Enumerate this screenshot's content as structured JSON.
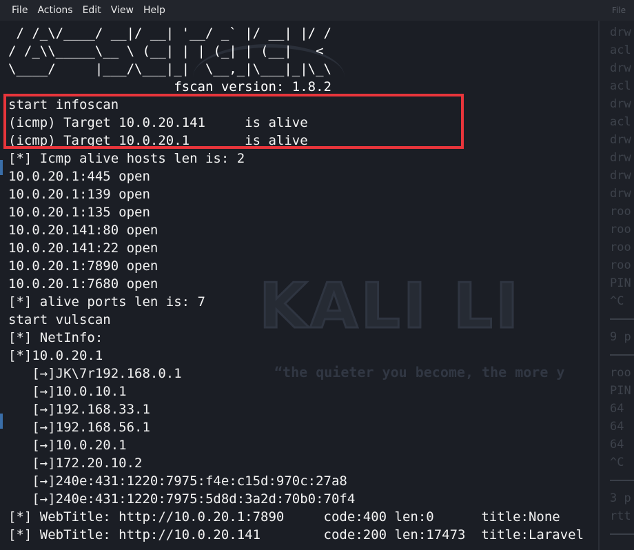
{
  "menu": [
    "File",
    "Actions",
    "Edit",
    "View",
    "Help"
  ],
  "menu_right": "File",
  "background": {
    "logo": "KALI LI",
    "tagline": "“the quieter you become, the more y"
  },
  "terminal": {
    "lines": [
      " / /_\\/____/ __|/ __| '__/ _` |/ __| |/ /",
      "/ /_\\\\_____\\__ \\ (__| | | (_| | (__|   <",
      "\\____/     |___/\\___|_|  \\__,_|\\___|_|\\_\\",
      "                     fscan version: 1.8.2",
      "start infoscan",
      "(icmp) Target 10.0.20.141     is alive",
      "(icmp) Target 10.0.20.1       is alive",
      "[*] Icmp alive hosts len is: 2",
      "10.0.20.1:445 open",
      "10.0.20.1:139 open",
      "10.0.20.1:135 open",
      "10.0.20.141:80 open",
      "10.0.20.141:22 open",
      "10.0.20.1:7890 open",
      "10.0.20.1:7680 open",
      "[*] alive ports len is: 7",
      "start vulscan",
      "[*] NetInfo:",
      "[*]10.0.20.1",
      "   [→]JK\\7r192.168.0.1",
      "   [→]10.0.10.1",
      "   [→]192.168.33.1",
      "   [→]192.168.56.1",
      "   [→]10.0.20.1",
      "   [→]172.20.10.2",
      "   [→]240e:431:1220:7975:f4e:c15d:970c:27a8",
      "   [→]240e:431:1220:7975:5d8d:3a2d:70b0:70f4",
      "[*] WebTitle: http://10.0.20.1:7890     code:400 len:0      title:None",
      "[*] WebTitle: http://10.0.20.141        code:200 len:17473  title:Laravel"
    ]
  },
  "side_pane": {
    "lines": [
      "drw",
      "acl",
      "drw",
      "acl",
      "drw",
      "acl",
      "drw",
      "drw",
      "drw",
      "drw",
      "roo",
      "roo",
      "roo",
      "roo",
      "PIN",
      "^C",
      "",
      "9 p",
      "",
      "roo",
      "PIN",
      "64",
      "64",
      "64",
      "^C",
      "",
      "3 p",
      "rtt",
      ""
    ]
  },
  "colors": {
    "highlight": "#e8353b",
    "terminal_bg": "#1b1e25",
    "text": "#f1f1f1"
  }
}
